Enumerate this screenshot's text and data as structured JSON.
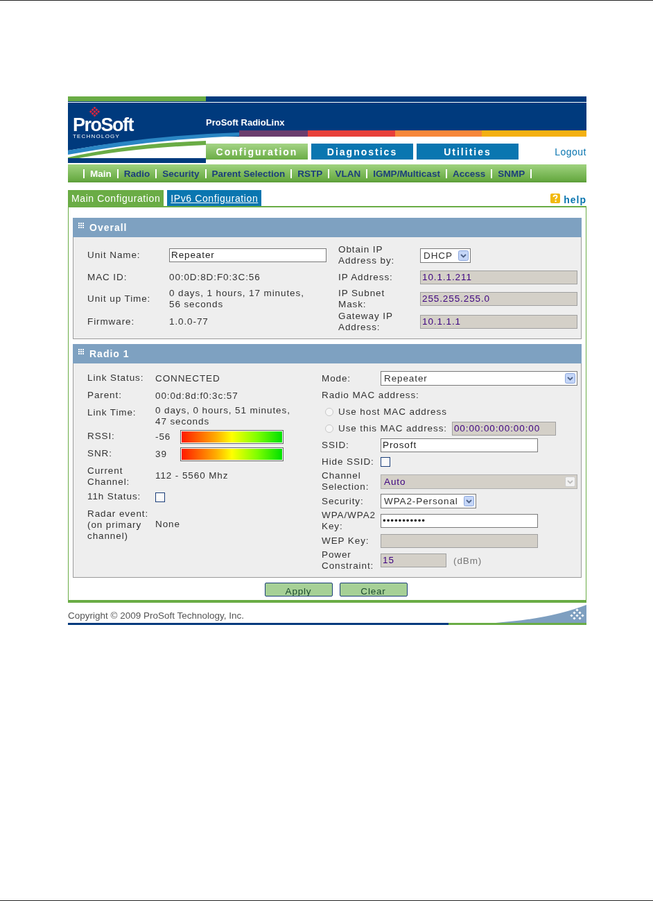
{
  "header": {
    "logo": {
      "name": "ProSoft",
      "tagline": "TECHNOLOGY"
    },
    "title": "ProSoft RadioLinx"
  },
  "main_tabs": [
    {
      "label": "Configuration",
      "selected": true
    },
    {
      "label": "Diagnostics",
      "selected": false
    },
    {
      "label": "Utilities",
      "selected": false
    }
  ],
  "logout": "Logout",
  "subnav": [
    {
      "label": "Main",
      "selected": true
    },
    {
      "label": "Radio",
      "selected": false
    },
    {
      "label": "Security",
      "selected": false
    },
    {
      "label": "Parent Selection",
      "selected": false
    },
    {
      "label": "RSTP",
      "selected": false
    },
    {
      "label": "VLAN",
      "selected": false
    },
    {
      "label": "IGMP/Multicast",
      "selected": false
    },
    {
      "label": "Access",
      "selected": false
    },
    {
      "label": "SNMP",
      "selected": false
    }
  ],
  "page_tabs": [
    {
      "label": "Main Configuration",
      "selected": true
    },
    {
      "label": "IPv6 Configuration",
      "selected": false
    }
  ],
  "help": "help",
  "overall": {
    "title": "Overall",
    "left": [
      {
        "label": "Unit Name:",
        "kind": "input",
        "value": "Repeater"
      },
      {
        "label": "MAC ID:",
        "kind": "text",
        "value": "00:0D:8D:F0:3C:56"
      },
      {
        "label": "Unit up Time:",
        "kind": "text",
        "value": "0 days, 1 hours, 17 minutes, 56 seconds"
      },
      {
        "label": "Firmware:",
        "kind": "text",
        "value": "1.0.0-77"
      }
    ],
    "right": [
      {
        "label": "Obtain IP Address by:",
        "kind": "select",
        "value": "DHCP"
      },
      {
        "label": "IP Address:",
        "kind": "readonly",
        "value": "10.1.1.211"
      },
      {
        "label": "IP Subnet Mask:",
        "kind": "readonly",
        "value": "255.255.255.0"
      },
      {
        "label": "Gateway IP Address:",
        "kind": "readonly",
        "value": "10.1.1.1"
      }
    ]
  },
  "radio": {
    "title": "Radio 1",
    "left": [
      {
        "label": "Link Status:",
        "kind": "text",
        "value": "CONNECTED"
      },
      {
        "label": "Parent:",
        "kind": "text",
        "value": "00:0d:8d:f0:3c:57"
      },
      {
        "label": "Link Time:",
        "kind": "text",
        "value": "0 days, 0 hours, 51 minutes, 47 seconds"
      },
      {
        "label": "RSSI:",
        "kind": "meter",
        "value": "-56",
        "level": 1
      },
      {
        "label": "SNR:",
        "kind": "meter",
        "value": "39",
        "level": 1
      },
      {
        "label": "Current Channel:",
        "kind": "text",
        "value": "112 - 5560 Mhz"
      },
      {
        "label": "11h Status:",
        "kind": "checkbox",
        "checked": false
      },
      {
        "label": "Radar event: (on primary channel)",
        "kind": "text",
        "value": "None"
      }
    ],
    "right": [
      {
        "label": "Mode:",
        "kind": "wideselect",
        "value": "Repeater",
        "disabled": false
      },
      {
        "label": "Radio MAC address:",
        "kind": "heading"
      },
      {
        "label": "Use host MAC address",
        "kind": "radio",
        "selected": false
      },
      {
        "label": "Use this MAC address:",
        "kind": "radio",
        "selected": false,
        "value": "00:00:00:00:00:00"
      },
      {
        "label": "SSID:",
        "kind": "input",
        "value": "Prosoft"
      },
      {
        "label": "Hide SSID:",
        "kind": "checkbox",
        "checked": false
      },
      {
        "label": "Channel Selection:",
        "kind": "wideselect",
        "value": "Auto",
        "disabled": true
      },
      {
        "label": "Security:",
        "kind": "select",
        "value": "WPA2-Personal"
      },
      {
        "label": "WPA/WPA2 Key:",
        "kind": "input",
        "value": "•••••••••••"
      },
      {
        "label": "WEP Key:",
        "kind": "readonly"
      },
      {
        "label": "Power Constraint:",
        "kind": "readonly",
        "value": "15",
        "unit": "(dBm)"
      }
    ]
  },
  "buttons": [
    "Apply",
    "Clear"
  ],
  "footer": "Copyright © 2009 ProSoft Technology, Inc."
}
